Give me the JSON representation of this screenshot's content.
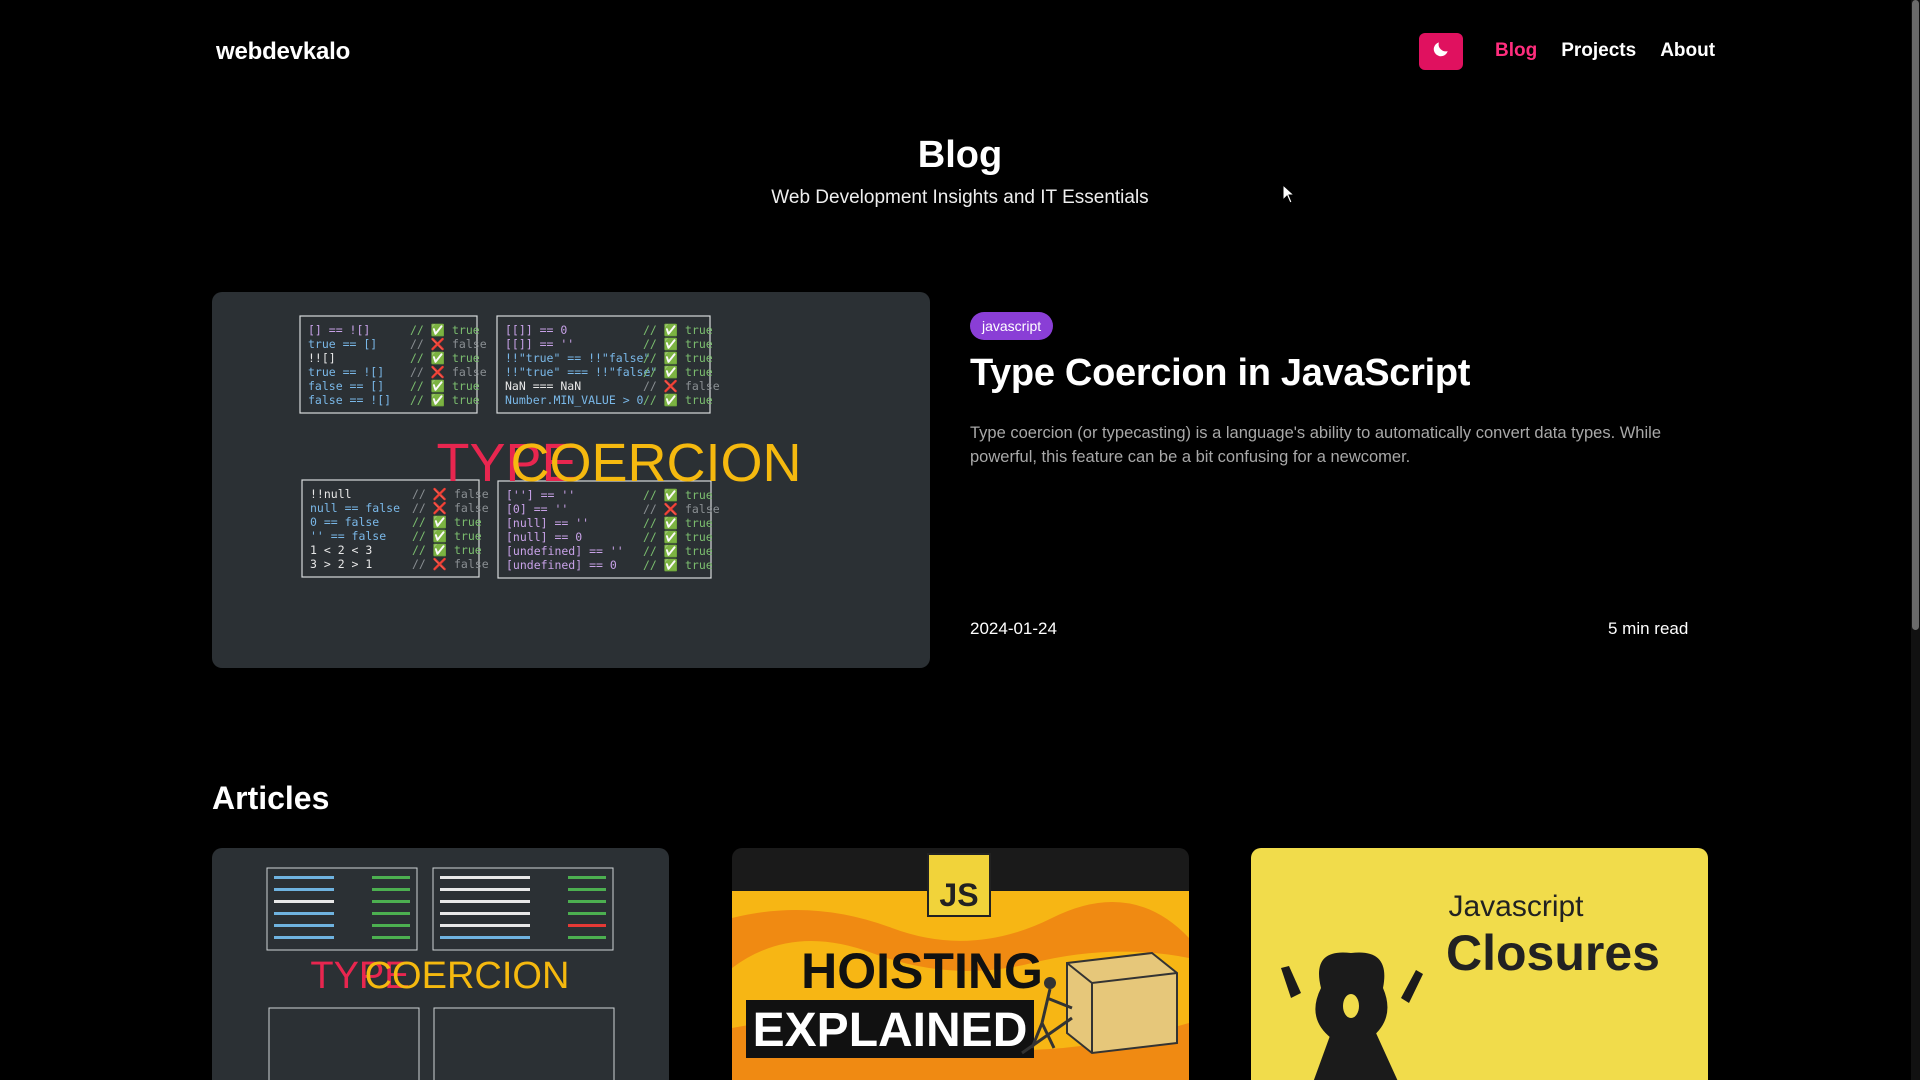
{
  "header": {
    "logo": "webdevkalo",
    "theme_icon": "moon-icon",
    "nav": [
      {
        "label": "Blog",
        "active": true
      },
      {
        "label": "Projects",
        "active": false
      },
      {
        "label": "About",
        "active": false
      }
    ]
  },
  "hero": {
    "title": "Blog",
    "subtitle": "Web Development Insights and IT Essentials"
  },
  "featured": {
    "tag": "javascript",
    "title": "Type Coercion in JavaScript",
    "description": "Type coercion (or typecasting) is a language's ability to automatically convert data types. While powerful, this feature can be a bit confusing for a newcomer.",
    "date": "2024-01-24",
    "read_time": "5 min read",
    "image": {
      "heading_type": "TYPE",
      "heading_coercion": "COERCION",
      "box1": [
        {
          "code": "[]    == ![]",
          "comment": "// ✅ true"
        },
        {
          "code": "true  ==  []",
          "comment": "// ❌ false"
        },
        {
          "code": "!![]",
          "comment": "// ✅ true"
        },
        {
          "code": "true  == ![]",
          "comment": "// ❌ false"
        },
        {
          "code": "false ==  []",
          "comment": "// ✅ true"
        },
        {
          "code": "false == ![]",
          "comment": "// ✅ true"
        }
      ],
      "box2": [
        {
          "code": "[[]] == 0",
          "comment": "// ✅ true"
        },
        {
          "code": "[[]] == ''",
          "comment": "// ✅ true"
        },
        {
          "code": "!!\"true\" == !!\"false\"",
          "comment": "// ✅ true"
        },
        {
          "code": "!!\"true\" === !!\"false\"",
          "comment": "// ✅ true"
        },
        {
          "code": "NaN === NaN",
          "comment": "// ❌ false"
        },
        {
          "code": "Number.MIN_VALUE > 0",
          "comment": "// ✅ true"
        }
      ],
      "box3": [
        {
          "code": "!!null",
          "comment": "// ❌ false"
        },
        {
          "code": "null == false",
          "comment": "// ❌ false"
        },
        {
          "code": "0 == false",
          "comment": "// ✅ true"
        },
        {
          "code": "'' == false",
          "comment": "// ✅ true"
        },
        {
          "code": "1 < 2 < 3",
          "comment": "// ✅ true"
        },
        {
          "code": "3 > 2 > 1",
          "comment": "// ❌ false"
        }
      ],
      "box4": [
        {
          "code": "[''] == ''",
          "comment": "// ✅ true"
        },
        {
          "code": "[0] == ''",
          "comment": "// ❌ false"
        },
        {
          "code": "[null] == ''",
          "comment": "// ✅ true"
        },
        {
          "code": "[null] == 0",
          "comment": "// ✅ true"
        },
        {
          "code": "[undefined] == ''",
          "comment": "// ✅ true"
        },
        {
          "code": "[undefined] == 0",
          "comment": "// ✅ true"
        }
      ]
    }
  },
  "articles": {
    "heading": "Articles",
    "cards": [
      {
        "image_heading_a": "TYPE",
        "image_heading_b": "COERCION"
      },
      {
        "badge": "JS",
        "line1": "HOISTING",
        "line2": "EXPLAINED"
      },
      {
        "line1": "Javascript",
        "line2": "Closures"
      }
    ]
  },
  "colors": {
    "accent": "#e0115f",
    "nav_active": "#ff2d7d",
    "tag": "#8a3ed6",
    "type_red": "#e8264f",
    "coercion_yellow": "#f5b90f"
  }
}
